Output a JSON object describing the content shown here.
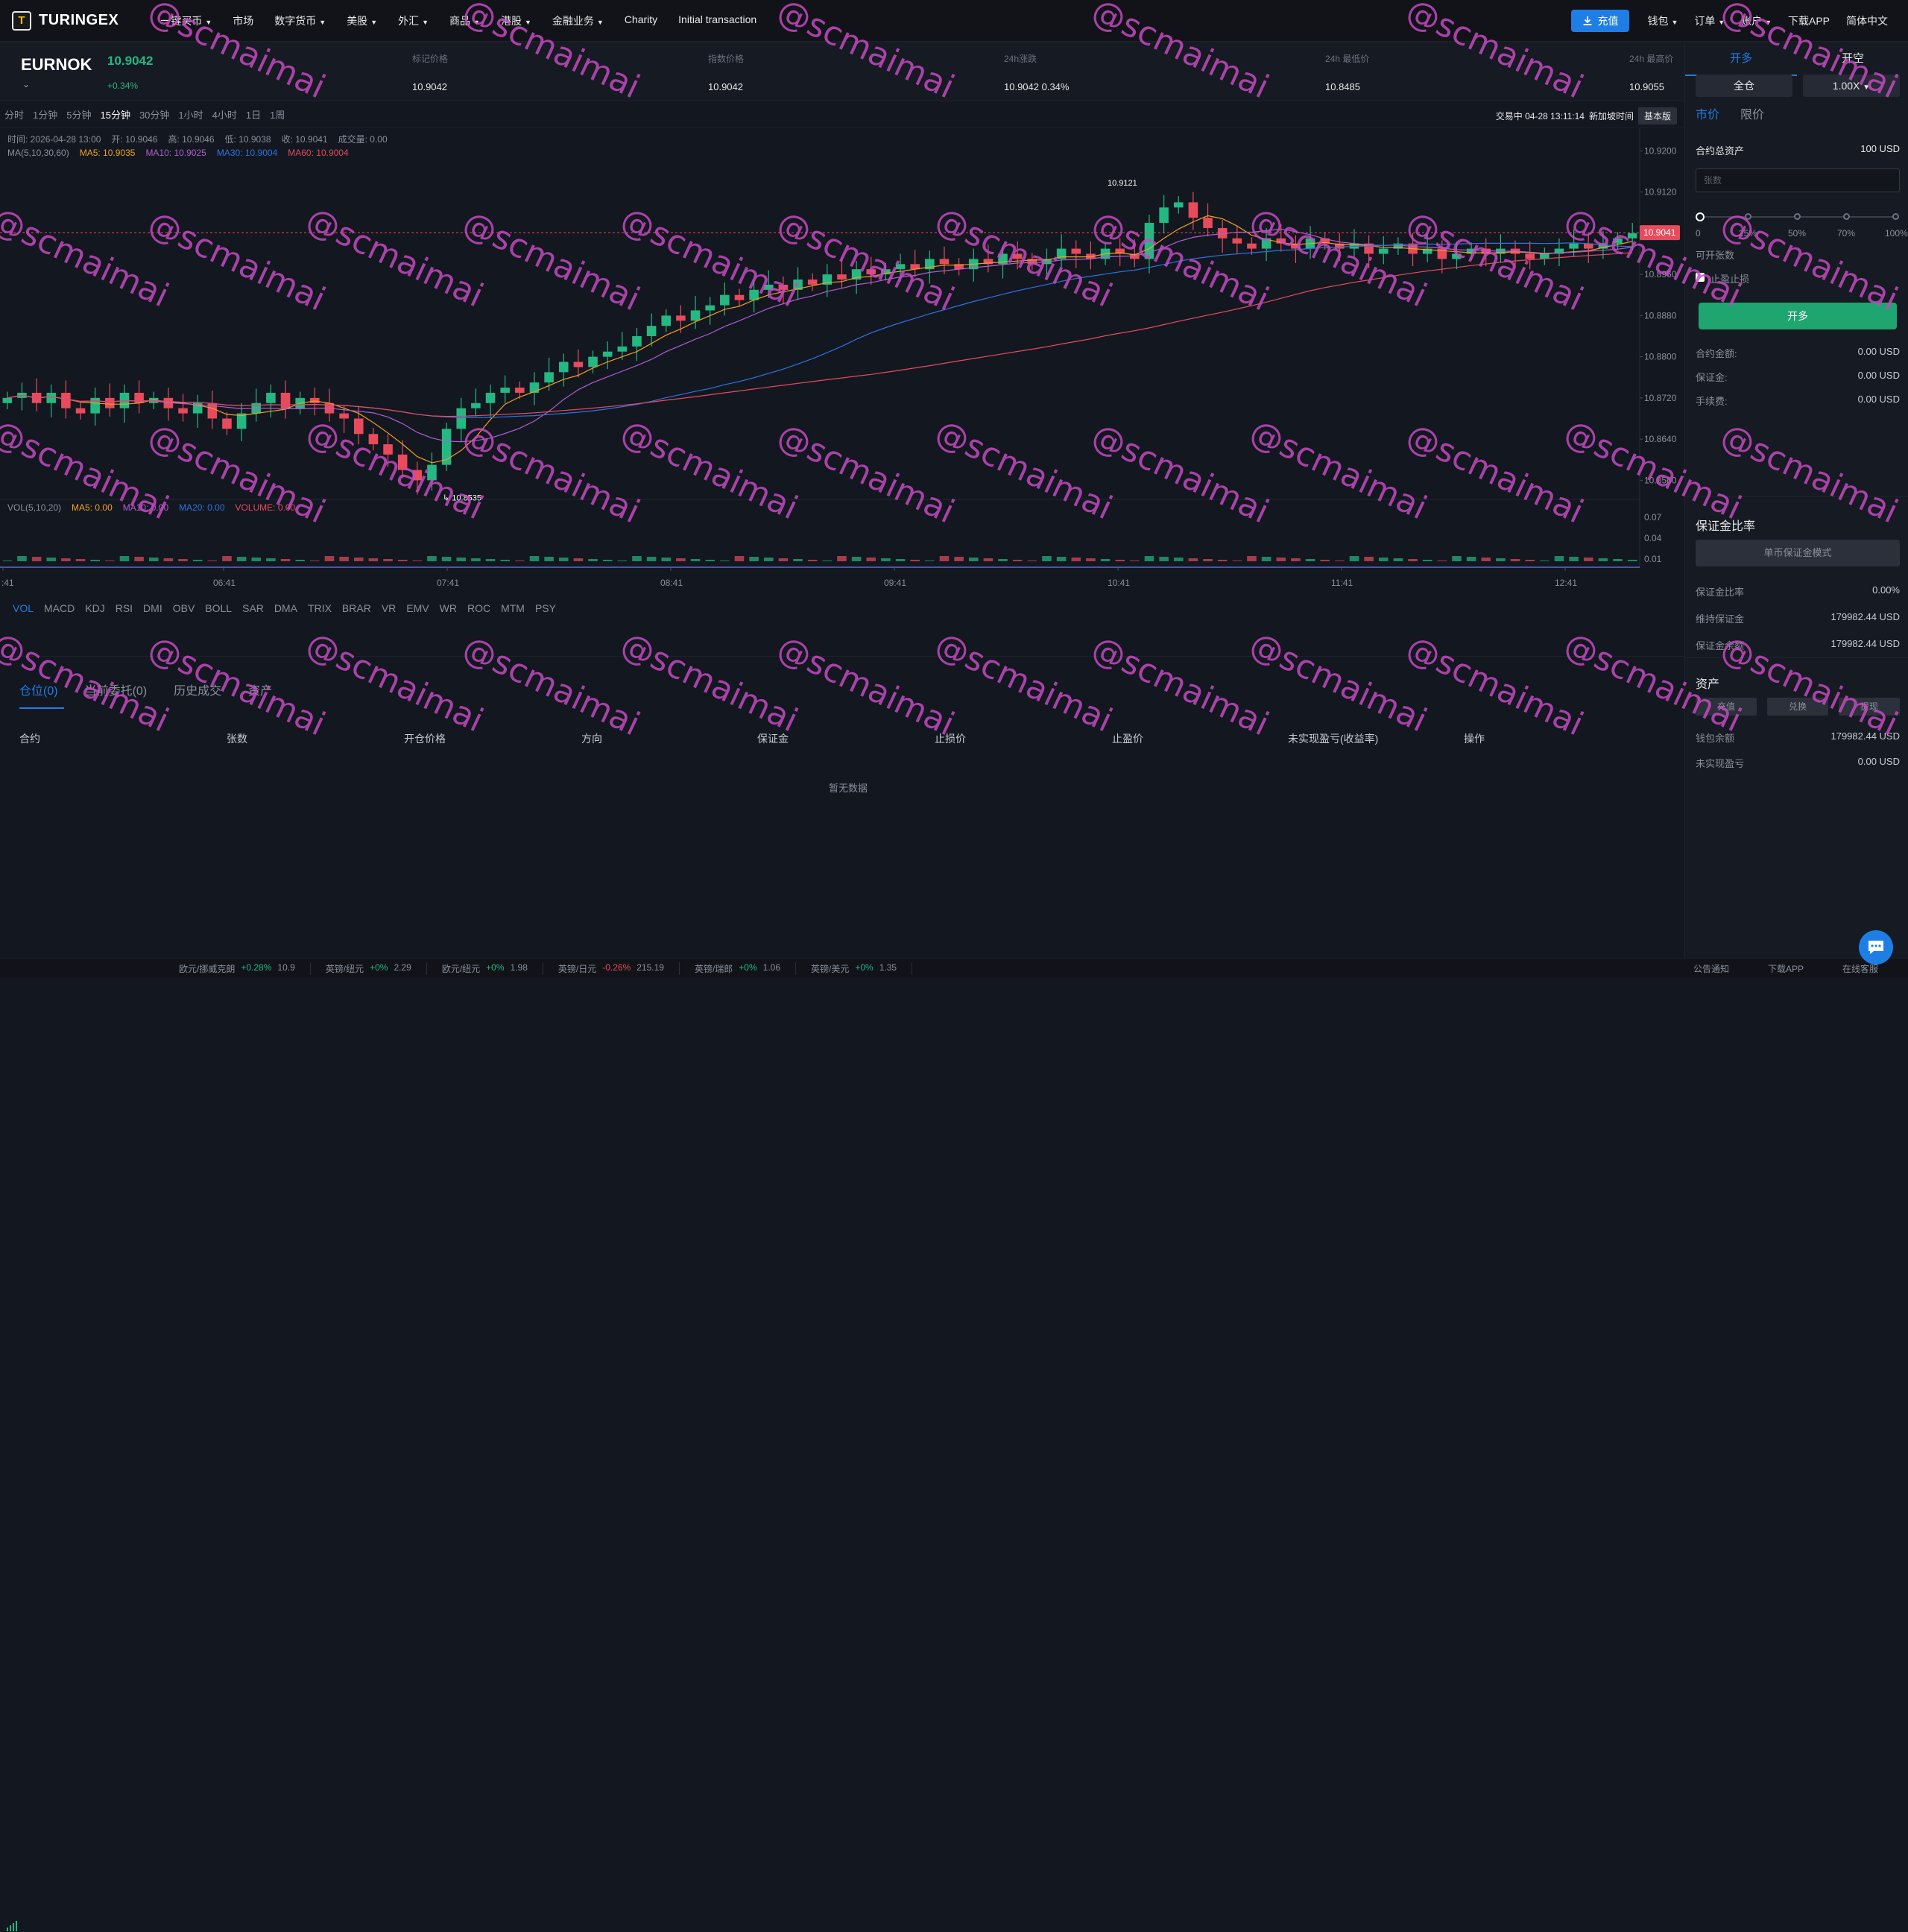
{
  "nav": {
    "logo_mark": "T",
    "logo_text": "TURINGEX",
    "items": [
      "一键买币",
      "市场",
      "数字货币",
      "美股",
      "外汇",
      "商品",
      "港股",
      "金融业务",
      "Charity",
      "Initial transaction"
    ],
    "deposit": "充值",
    "right": [
      "钱包",
      "订单",
      "账户",
      "下载APP",
      "简体中文"
    ]
  },
  "ticker": {
    "symbol": "EURNOK",
    "last_price": "10.9042",
    "change": "+0.34%",
    "stats": [
      {
        "label": "标记价格",
        "value": "10.9042"
      },
      {
        "label": "指数价格",
        "value": "10.9042"
      },
      {
        "label": "24h涨跌",
        "value": "10.9042  0.34%"
      },
      {
        "label": "24h 最低价",
        "value": "10.8485"
      },
      {
        "label": "24h 最高价",
        "value": "10.9055"
      }
    ]
  },
  "timeframes": [
    "分时",
    "1分钟",
    "5分钟",
    "15分钟",
    "30分钟",
    "1小时",
    "4小时",
    "1日",
    "1周"
  ],
  "active_tf": "15分钟",
  "tf_right": {
    "status": "交易中 04-28 13:11:14",
    "new_time": "新加坡时间",
    "basic": "基本版"
  },
  "chart_info": {
    "time": "时间: 2026-04-28 13:00",
    "open": "开: 10.9046",
    "high": "高: 10.9046",
    "low": "低: 10.9038",
    "close": "收: 10.9041",
    "volume": "成交量: 0.00"
  },
  "ma_legend": {
    "label": "MA(5,10,30,60)",
    "ma5": "MA5: 10.9035",
    "ma10": "MA10: 10.9025",
    "ma30": "MA30: 10.9004",
    "ma60": "MA60: 10.9004"
  },
  "vol_legend": {
    "label": "VOL(5,10,20)",
    "ma5": "MA5: 0.00",
    "ma10": "MA10: 0.00",
    "ma20": "MA20: 0.00",
    "volume": "VOLUME: 0.00"
  },
  "indicators": [
    "VOL",
    "MACD",
    "KDJ",
    "RSI",
    "DMI",
    "OBV",
    "BOLL",
    "SAR",
    "DMA",
    "TRIX",
    "BRAR",
    "VR",
    "EMV",
    "WR",
    "ROC",
    "MTM",
    "PSY"
  ],
  "chart_data": {
    "type": "candlestick",
    "symbol": "EURNOK",
    "interval": "15分钟",
    "price_ticks": [
      "10.9200",
      "10.9120",
      "10.9040",
      "10.8960",
      "10.8880",
      "10.8800",
      "10.8720",
      "10.8640",
      "10.8560"
    ],
    "price_range": [
      10.852,
      10.9215
    ],
    "time_ticks": [
      ":41",
      "06:41",
      "07:41",
      "08:41",
      "09:41",
      "10:41",
      "11:41",
      "12:41"
    ],
    "volume_ticks": [
      "0.07",
      "0.04",
      "0.01"
    ],
    "current_price": "10.9041",
    "high_marker": "10.9121",
    "low_marker": "10.8535",
    "closes": [
      10.872,
      10.873,
      10.871,
      10.873,
      10.87,
      10.869,
      10.872,
      10.87,
      10.873,
      10.871,
      10.872,
      10.87,
      10.869,
      10.871,
      10.868,
      10.866,
      10.869,
      10.871,
      10.873,
      10.87,
      10.872,
      10.871,
      10.869,
      10.868,
      10.865,
      10.863,
      10.861,
      10.858,
      10.856,
      10.859,
      10.866,
      10.87,
      10.871,
      10.873,
      10.874,
      10.873,
      10.875,
      10.877,
      10.879,
      10.878,
      10.88,
      10.881,
      10.882,
      10.884,
      10.886,
      10.888,
      10.887,
      10.889,
      10.89,
      10.892,
      10.891,
      10.893,
      10.894,
      10.893,
      10.895,
      10.894,
      10.896,
      10.895,
      10.897,
      10.896,
      10.897,
      10.898,
      10.897,
      10.899,
      10.898,
      10.897,
      10.899,
      10.898,
      10.9,
      10.899,
      10.898,
      10.899,
      10.901,
      10.9,
      10.899,
      10.901,
      10.9,
      10.899,
      10.906,
      10.909,
      10.91,
      10.907,
      10.905,
      10.903,
      10.902,
      10.901,
      10.903,
      10.902,
      10.901,
      10.903,
      10.902,
      10.901,
      10.902,
      10.9,
      10.901,
      10.902,
      10.9,
      10.901,
      10.899,
      10.9,
      10.901,
      10.9,
      10.901,
      10.9,
      10.899,
      10.9,
      10.901,
      10.902,
      10.901,
      10.902,
      10.903,
      10.904
    ]
  },
  "positions": {
    "tabs": [
      "仓位(0)",
      "当前委托(0)",
      "历史成交",
      "资产"
    ],
    "columns": [
      "合约",
      "张数",
      "开仓价格",
      "方向",
      "保证金",
      "止损价",
      "止盈价",
      "未实现盈亏(收益率)",
      "操作"
    ],
    "empty": "暂无数据"
  },
  "order": {
    "tab_long": "开多",
    "tab_short": "开空",
    "margin_mode": "全仓",
    "leverage": "1.00X",
    "type_market": "市价",
    "type_limit": "限价",
    "total_assets_label": "合约总资产",
    "total_assets_value": "100 USD",
    "qty_placeholder": "张数",
    "slider_labels": [
      "0",
      "25%",
      "50%",
      "70%",
      "100%"
    ],
    "available_qty": "可开张数",
    "tpsl": "止盈止损",
    "open_long_btn": "开多",
    "rows": [
      {
        "label": "合约金额:",
        "value": "0.00 USD"
      },
      {
        "label": "保证金:",
        "value": "0.00 USD"
      },
      {
        "label": "手续费:",
        "value": "0.00 USD"
      }
    ]
  },
  "margin": {
    "title": "保证金比率",
    "mode_btn": "单币保证金模式",
    "rows": [
      {
        "label": "保证金比率",
        "value": "0.00%"
      },
      {
        "label": "维持保证金",
        "value": "179982.44 USD"
      },
      {
        "label": "保证金余额",
        "value": "179982.44 USD"
      }
    ]
  },
  "assets": {
    "title": "资产",
    "buttons": [
      "充值",
      "兑换",
      "提现"
    ],
    "rows": [
      {
        "label": "钱包余额",
        "value": "179982.44 USD"
      },
      {
        "label": "未实现盈亏",
        "value": "0.00 USD"
      }
    ]
  },
  "statusbar": {
    "tickers": [
      {
        "name": "欧元/挪威克朗",
        "change": "+0.28%",
        "price": "10.9",
        "dir": "up"
      },
      {
        "name": "英镑/纽元",
        "change": "+0%",
        "price": "2.29",
        "dir": "up"
      },
      {
        "name": "欧元/纽元",
        "change": "+0%",
        "price": "1.98",
        "dir": "up"
      },
      {
        "name": "英镑/日元",
        "change": "-0.26%",
        "price": "215.19",
        "dir": "dn"
      },
      {
        "name": "英镑/瑞郎",
        "change": "+0%",
        "price": "1.06",
        "dir": "up"
      },
      {
        "name": "英镑/美元",
        "change": "+0%",
        "price": "1.35",
        "dir": "up"
      }
    ],
    "right": [
      "公告通知",
      "下载APP",
      "在线客服"
    ]
  },
  "watermark": "@scmaimai",
  "colors": {
    "up": "#25b882",
    "down": "#e84b5c",
    "accent": "#1e7ee6",
    "ma5": "#f0a020",
    "ma10": "#b05fd0",
    "ma30": "#2e73e0",
    "ma60": "#e84b5c"
  }
}
